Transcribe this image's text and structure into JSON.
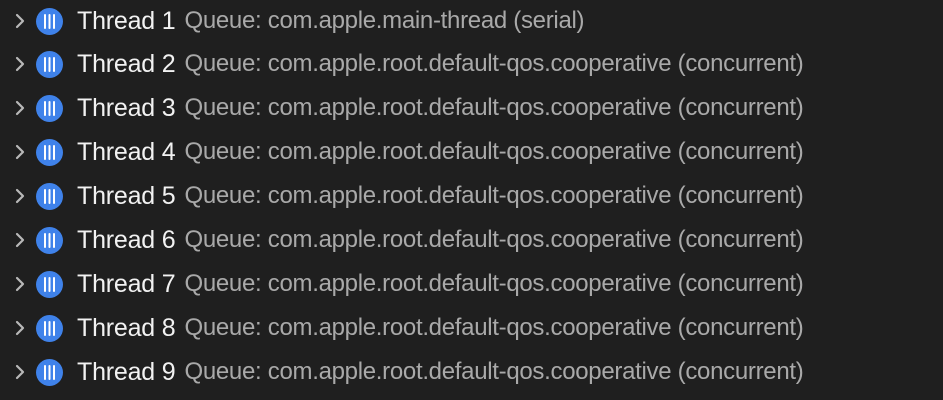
{
  "threads": [
    {
      "name": "Thread 1",
      "queue": "Queue: com.apple.main-thread (serial)"
    },
    {
      "name": "Thread 2",
      "queue": "Queue: com.apple.root.default-qos.cooperative (concurrent)"
    },
    {
      "name": "Thread 3",
      "queue": "Queue: com.apple.root.default-qos.cooperative (concurrent)"
    },
    {
      "name": "Thread 4",
      "queue": "Queue: com.apple.root.default-qos.cooperative (concurrent)"
    },
    {
      "name": "Thread 5",
      "queue": "Queue: com.apple.root.default-qos.cooperative (concurrent)"
    },
    {
      "name": "Thread 6",
      "queue": "Queue: com.apple.root.default-qos.cooperative (concurrent)"
    },
    {
      "name": "Thread 7",
      "queue": "Queue: com.apple.root.default-qos.cooperative (concurrent)"
    },
    {
      "name": "Thread 8",
      "queue": "Queue: com.apple.root.default-qos.cooperative (concurrent)"
    },
    {
      "name": "Thread 9",
      "queue": "Queue: com.apple.root.default-qos.cooperative (concurrent)"
    }
  ],
  "icons": {
    "disclosure": "chevron-right-icon",
    "thread": "thread-icon"
  },
  "colors": {
    "background": "#1f1f1f",
    "thread_icon": "#3f82ea",
    "thread_name": "#f2f2f2",
    "queue_text": "#a9a9a9"
  }
}
